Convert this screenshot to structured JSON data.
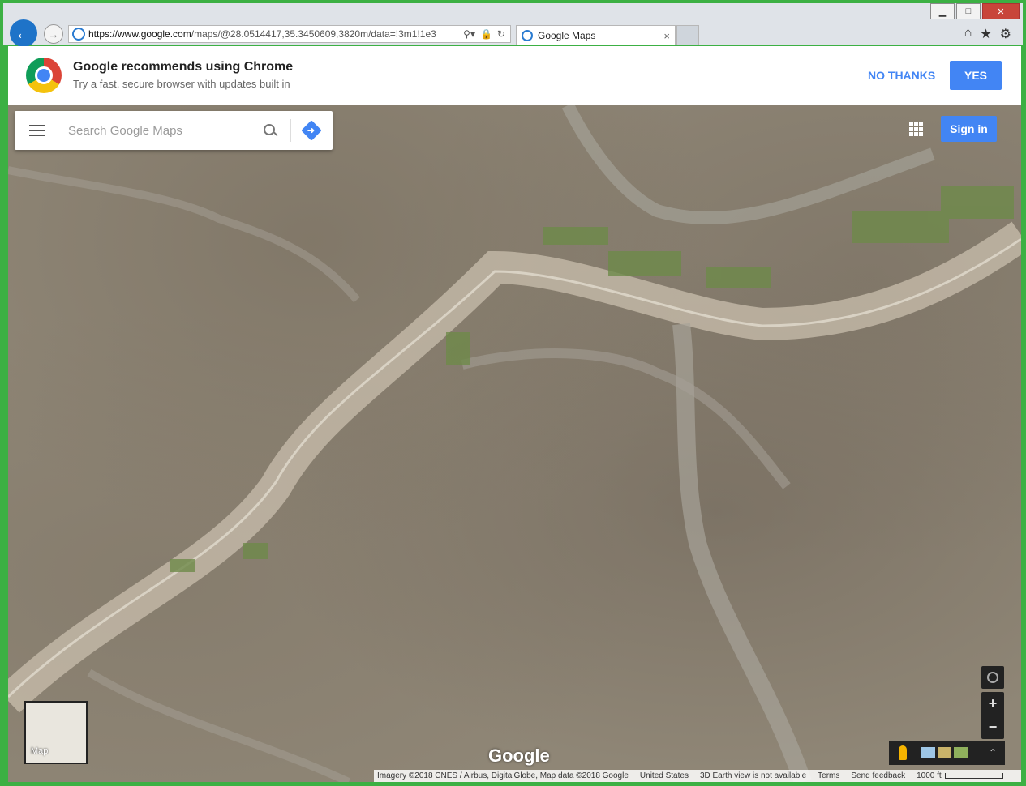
{
  "browser": {
    "url_host": "https://www.google.com",
    "url_path": "/maps/@28.0514417,35.3450609,3820m/data=!3m1!1e3",
    "tab_title": "Google Maps",
    "tab_close": "×",
    "window_controls": [
      "▁",
      "□",
      "✕"
    ],
    "toolbar_icons": [
      "home-icon",
      "star-icon",
      "gear-icon"
    ]
  },
  "banner": {
    "title": "Google recommends using Chrome",
    "subtitle": "Try a fast, secure browser with updates built in",
    "no_thanks": "NO THANKS",
    "yes": "YES"
  },
  "search": {
    "placeholder": "Search Google Maps"
  },
  "header": {
    "sign_in": "Sign in"
  },
  "map": {
    "minimap_label": "Map",
    "logo": "Google",
    "zoom_in": "+",
    "zoom_out": "−",
    "expand": "⌃",
    "footer": {
      "imagery": "Imagery ©2018 CNES / Airbus, DigitalGlobe, Map data ©2018 Google",
      "country": "United States",
      "earth_view": "3D Earth view is not available",
      "terms": "Terms",
      "feedback": "Send feedback",
      "scale": "1000 ft"
    }
  },
  "colors": {
    "accent": "#4285f4",
    "window_border": "#3cb043"
  }
}
